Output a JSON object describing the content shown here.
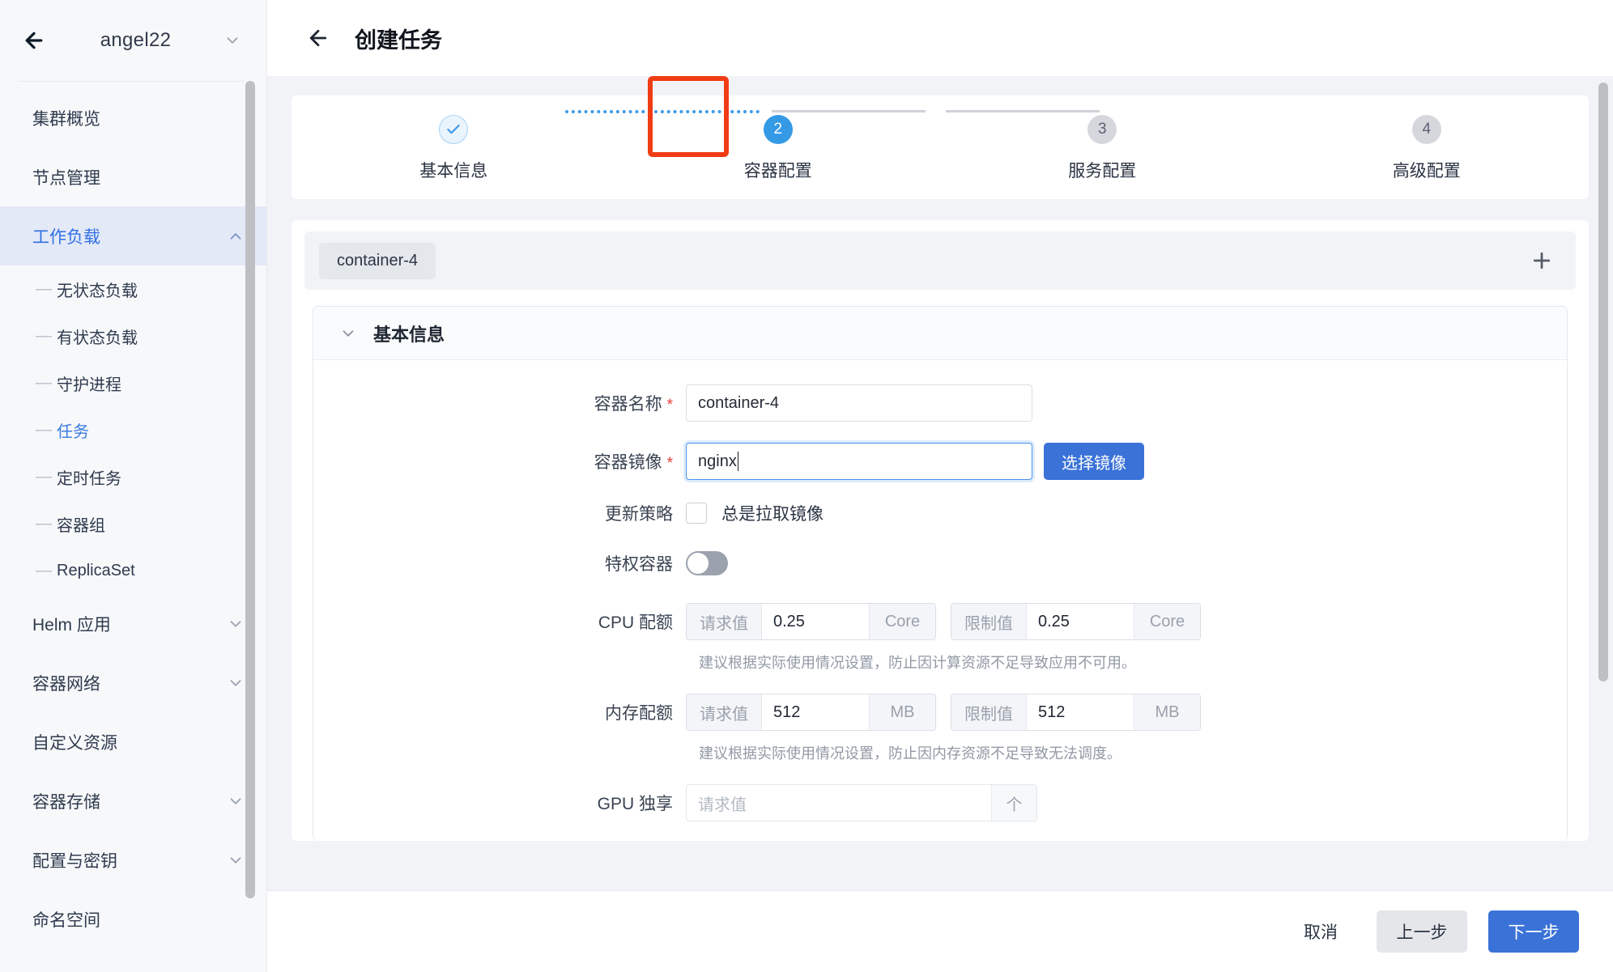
{
  "sidebar": {
    "cluster_name": "angel22",
    "back_icon": "arrow-left-icon",
    "chevron_icon": "chevron-down-icon",
    "items": [
      {
        "label": "集群概览",
        "type": "item",
        "active": false,
        "chevron": ""
      },
      {
        "label": "节点管理",
        "type": "item",
        "active": false,
        "chevron": ""
      },
      {
        "label": "工作负载",
        "type": "item",
        "active": true,
        "chevron": "chevron-up-icon"
      },
      {
        "label": "无状态负载",
        "type": "sub",
        "selected": false
      },
      {
        "label": "有状态负载",
        "type": "sub",
        "selected": false
      },
      {
        "label": "守护进程",
        "type": "sub",
        "selected": false
      },
      {
        "label": "任务",
        "type": "sub",
        "selected": true
      },
      {
        "label": "定时任务",
        "type": "sub",
        "selected": false
      },
      {
        "label": "容器组",
        "type": "sub",
        "selected": false
      },
      {
        "label": "ReplicaSet",
        "type": "sub",
        "selected": false
      },
      {
        "label": "Helm 应用",
        "type": "item",
        "active": false,
        "chevron": "chevron-down-icon"
      },
      {
        "label": "容器网络",
        "type": "item",
        "active": false,
        "chevron": "chevron-down-icon"
      },
      {
        "label": "自定义资源",
        "type": "item",
        "active": false,
        "chevron": ""
      },
      {
        "label": "容器存储",
        "type": "item",
        "active": false,
        "chevron": "chevron-down-icon"
      },
      {
        "label": "配置与密钥",
        "type": "item",
        "active": false,
        "chevron": "chevron-down-icon"
      },
      {
        "label": "命名空间",
        "type": "item",
        "active": false,
        "chevron": ""
      }
    ]
  },
  "header": {
    "back_icon": "arrow-left-icon",
    "title": "创建任务"
  },
  "stepper": {
    "highlight_color": "#f03c14",
    "steps": [
      {
        "num": "✓",
        "label": "基本信息",
        "state": "done"
      },
      {
        "num": "2",
        "label": "容器配置",
        "state": "current"
      },
      {
        "num": "3",
        "label": "服务配置",
        "state": "pending"
      },
      {
        "num": "4",
        "label": "高级配置",
        "state": "pending"
      }
    ]
  },
  "containers": {
    "tabs": [
      {
        "label": "container-4",
        "active": true
      }
    ],
    "add_icon": "plus-icon"
  },
  "section": {
    "chevron_icon": "chevron-down-icon",
    "title": "基本信息"
  },
  "form": {
    "container_name": {
      "label": "容器名称",
      "required_mark": "*",
      "value": "container-4",
      "placeholder": ""
    },
    "container_image": {
      "label": "容器镜像",
      "required_mark": "*",
      "value": "nginx",
      "placeholder": "",
      "select_button": "选择镜像"
    },
    "update_policy": {
      "label": "更新策略",
      "checkbox_label": "总是拉取镜像",
      "checked": false
    },
    "privileged": {
      "label": "特权容器",
      "on": false
    },
    "cpu_quota": {
      "label": "CPU 配额",
      "request_addon": "请求值",
      "request_value": "0.25",
      "request_unit": "Core",
      "limit_addon": "限制值",
      "limit_value": "0.25",
      "limit_unit": "Core",
      "hint": "建议根据实际使用情况设置，防止因计算资源不足导致应用不可用。"
    },
    "memory_quota": {
      "label": "内存配额",
      "request_addon": "请求值",
      "request_value": "512",
      "request_unit": "MB",
      "limit_addon": "限制值",
      "limit_value": "512",
      "limit_unit": "MB",
      "hint": "建议根据实际使用情况设置，防止因内存资源不足导致无法调度。"
    },
    "gpu": {
      "label": "GPU 独享",
      "placeholder": "请求值",
      "value": "",
      "unit": "个"
    }
  },
  "footer": {
    "cancel": "取消",
    "prev": "上一步",
    "next": "下一步"
  }
}
